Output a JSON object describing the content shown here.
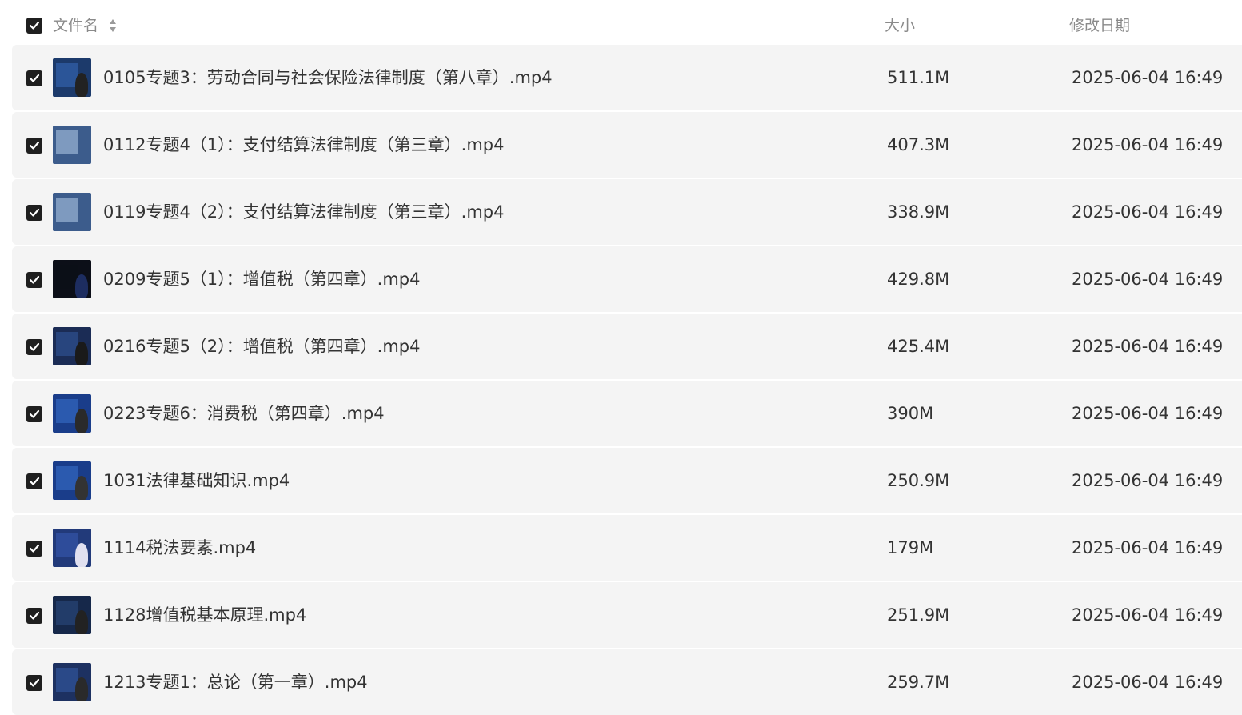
{
  "header": {
    "name_label": "文件名",
    "size_label": "大小",
    "date_label": "修改日期",
    "select_all_checked": true
  },
  "files": [
    {
      "name": "0105专题3：劳动合同与社会保险法律制度（第八章）.mp4",
      "size": "511.1M",
      "date": "2025-06-04 16:49",
      "checked": true
    },
    {
      "name": "0112专题4（1）：支付结算法律制度（第三章）.mp4",
      "size": "407.3M",
      "date": "2025-06-04 16:49",
      "checked": true
    },
    {
      "name": "0119专题4（2）：支付结算法律制度（第三章）.mp4",
      "size": "338.9M",
      "date": "2025-06-04 16:49",
      "checked": true
    },
    {
      "name": "0209专题5（1）：增值税（第四章）.mp4",
      "size": "429.8M",
      "date": "2025-06-04 16:49",
      "checked": true
    },
    {
      "name": "0216专题5（2）：增值税（第四章）.mp4",
      "size": "425.4M",
      "date": "2025-06-04 16:49",
      "checked": true
    },
    {
      "name": "0223专题6：消费税（第四章）.mp4",
      "size": "390M",
      "date": "2025-06-04 16:49",
      "checked": true
    },
    {
      "name": "1031法律基础知识.mp4",
      "size": "250.9M",
      "date": "2025-06-04 16:49",
      "checked": true
    },
    {
      "name": "1114税法要素.mp4",
      "size": "179M",
      "date": "2025-06-04 16:49",
      "checked": true
    },
    {
      "name": "1128增值税基本原理.mp4",
      "size": "251.9M",
      "date": "2025-06-04 16:49",
      "checked": true
    },
    {
      "name": "1213专题1：总论（第一章）.mp4",
      "size": "259.7M",
      "date": "2025-06-04 16:49",
      "checked": true
    }
  ],
  "icons": {
    "checkbox": "checkbox-checked-icon",
    "sort": "sort-icon",
    "thumbnail": "video-thumbnail"
  },
  "colors": {
    "row_bg": "#f4f4f4",
    "checkbox": "#1f1f1f",
    "header_text": "#8a8a8a",
    "text": "#333333"
  }
}
